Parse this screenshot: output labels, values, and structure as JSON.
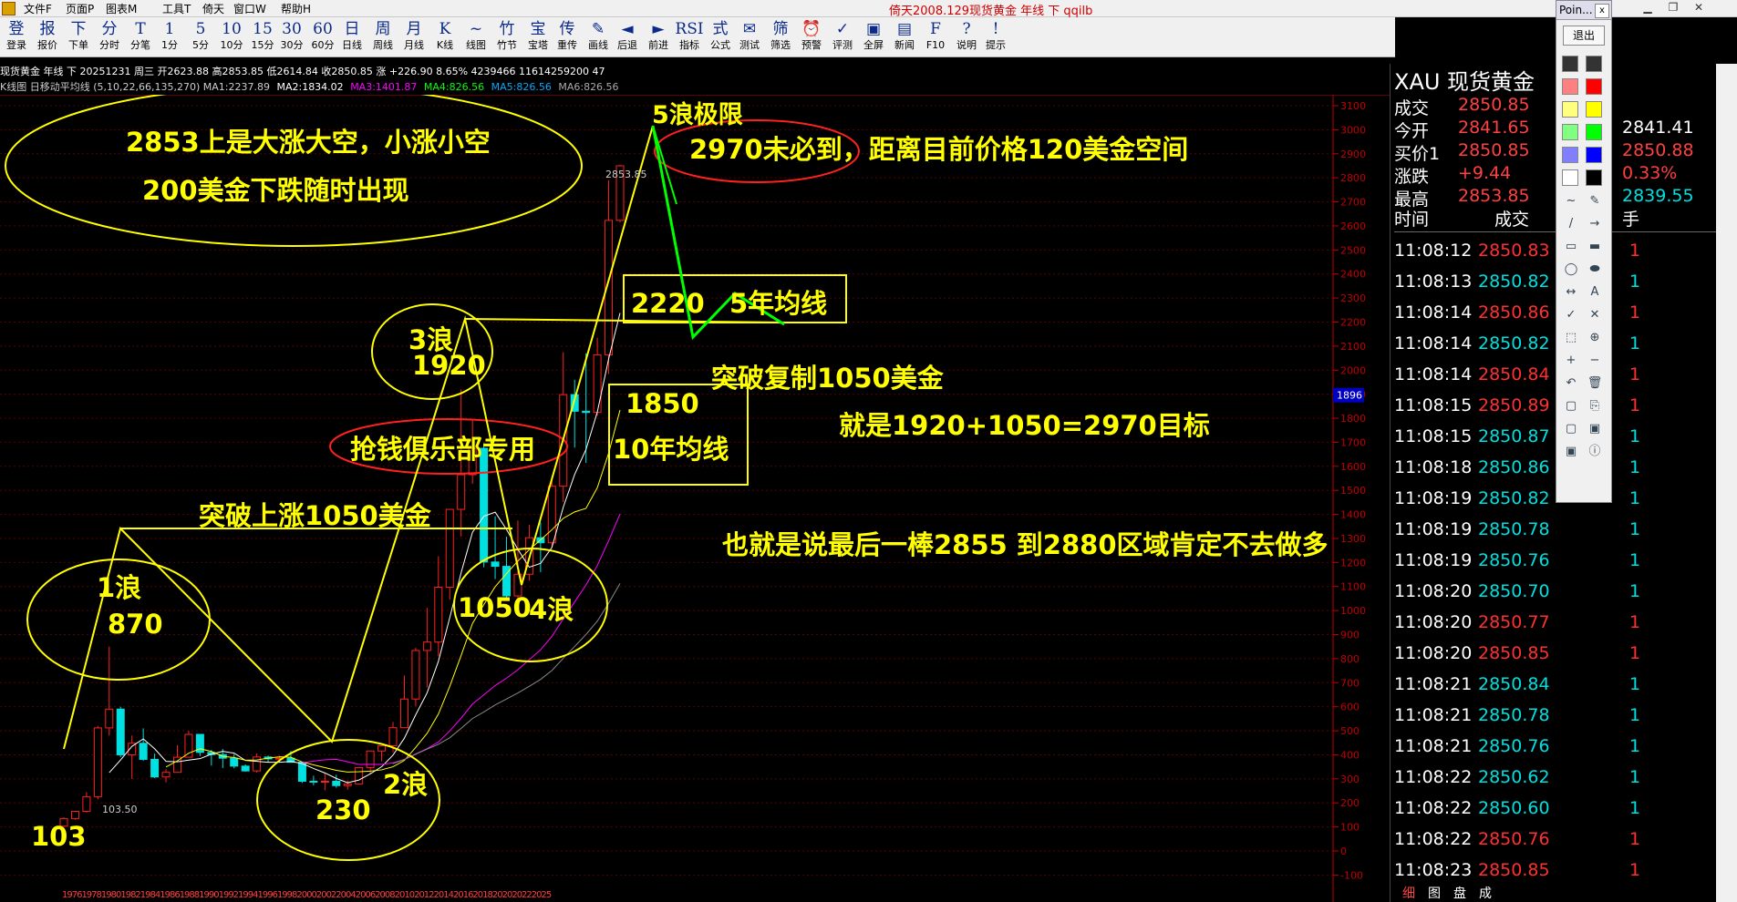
{
  "menu": [
    "文件F",
    "页面P",
    "图表M",
    "工具T",
    "倚天",
    "窗口W",
    "帮助H"
  ],
  "window_title": "倚天2008.129现货黄金 年线 下 qqilb",
  "toolbar": [
    {
      "icon": "登",
      "label": "登录"
    },
    {
      "icon": "报",
      "label": "报价"
    },
    {
      "icon": "下",
      "label": "下单"
    },
    {
      "icon": "分",
      "label": "分时"
    },
    {
      "icon": "T",
      "label": "分笔"
    },
    {
      "icon": "1",
      "label": "1分"
    },
    {
      "icon": "5",
      "label": "5分"
    },
    {
      "icon": "10",
      "label": "10分"
    },
    {
      "icon": "15",
      "label": "15分"
    },
    {
      "icon": "30",
      "label": "30分"
    },
    {
      "icon": "60",
      "label": "60分"
    },
    {
      "icon": "日",
      "label": "日线"
    },
    {
      "icon": "周",
      "label": "周线"
    },
    {
      "icon": "月",
      "label": "月线"
    },
    {
      "icon": "K",
      "label": "K线"
    },
    {
      "icon": "~",
      "label": "线图"
    },
    {
      "icon": "竹",
      "label": "竹节"
    },
    {
      "icon": "宝",
      "label": "宝塔"
    },
    {
      "icon": "传",
      "label": "重传"
    },
    {
      "icon": "✎",
      "label": "画线"
    },
    {
      "icon": "◄",
      "label": "后退"
    },
    {
      "icon": "►",
      "label": "前进"
    },
    {
      "icon": "RSI",
      "label": "指标"
    },
    {
      "icon": "式",
      "label": "公式"
    },
    {
      "icon": "✉",
      "label": "测试"
    },
    {
      "icon": "筛",
      "label": "筛选"
    },
    {
      "icon": "⏰",
      "label": "预警"
    },
    {
      "icon": "✓",
      "label": "评测"
    },
    {
      "icon": "▣",
      "label": "全屏"
    },
    {
      "icon": "▤",
      "label": "新闻"
    },
    {
      "icon": "F",
      "label": "F10"
    },
    {
      "icon": "?",
      "label": "说明"
    },
    {
      "icon": "!",
      "label": "提示"
    }
  ],
  "info1": "现货黄金 年线 下 20251231 周三 开2623.88 高2853.85 低2614.84 收2850.85 涨 +226.90 8.65% 4239466 11614259200 47",
  "info2": {
    "prefix": "K线图 日移动平均线 (5,10,22,66,135,270) MA1:2237.89",
    "ma2": "MA2:1834.02",
    "ma3": "MA3:1401.87",
    "ma4": "MA4:826.56",
    "ma5": "MA5:826.56",
    "ma6": "MA6:826.56",
    "colors": {
      "ma2": "#ffffff",
      "ma3": "#ff00ff",
      "ma4": "#00ff00",
      "ma5": "#00aaff",
      "ma6": "#aaaaaa"
    }
  },
  "price_axis": [
    "3100",
    "3000",
    "2900",
    "2800",
    "2700",
    "2600",
    "2500",
    "2400",
    "2300",
    "2200",
    "2100",
    "2000",
    "1900",
    "1800",
    "1700",
    "1600",
    "1500",
    "1400",
    "1300",
    "1200",
    "1100",
    "1000",
    "900",
    "800",
    "700",
    "600",
    "500",
    "400",
    "300",
    "200",
    "100",
    "0",
    "-100"
  ],
  "price_highlight": "1896",
  "chart_labels": {
    "high": "2853.85",
    "low": "103.50"
  },
  "x_axis_labels": "1976197819801982198419861988199019921994199619982000200220042006200820102012201420162018202020222025",
  "annotations": {
    "a1": "2853上是大涨大空，小涨小空",
    "a2": "200美金下跌随时出现",
    "a3": "5浪极限",
    "a4": "2970未必到，距离目前价格120美金空间",
    "a5": "2220",
    "a6": "5年均线",
    "a7": "3浪",
    "a8": "1920",
    "a9": "突破复制1050美金",
    "a10": "1850",
    "a11": "10年均线",
    "a12": "就是1920+1050=2970目标",
    "a13": "抢钱俱乐部专用",
    "a14": "突破上涨1050美金",
    "a15": "也就是说最后一棒2855 到2880区域肯定不去做多",
    "a16": "1浪",
    "a17": "870",
    "a18": "1050",
    "a19": "4浪",
    "a20": "230",
    "a21": "2浪",
    "a22": "103"
  },
  "quote": {
    "title": "XAU 现货黄金",
    "rows": [
      {
        "k1": "成交",
        "v1": "2850.85",
        "k2": "",
        "v2": ""
      },
      {
        "k1": "今开",
        "v1": "2841.65",
        "k2": "",
        "v2": "2841.41"
      },
      {
        "k1": "买价1",
        "v1": "2850.85",
        "k2": "",
        "v2": "2850.88"
      },
      {
        "k1": "涨跌",
        "v1": "+9.44",
        "k2": "",
        "v2": "0.33%"
      },
      {
        "k1": "最高",
        "v1": "2853.85",
        "k2": "",
        "v2": "2839.55"
      }
    ],
    "tick_header": [
      "时间",
      "成交",
      "手"
    ],
    "ticks": [
      {
        "t": "11:08:12",
        "p": "2850.83",
        "v": "1",
        "c": "#ff3030"
      },
      {
        "t": "11:08:13",
        "p": "2850.82",
        "v": "1",
        "c": "#00e0e0"
      },
      {
        "t": "11:08:14",
        "p": "2850.86",
        "v": "1",
        "c": "#ff3030"
      },
      {
        "t": "11:08:14",
        "p": "2850.82",
        "v": "1",
        "c": "#00e0e0"
      },
      {
        "t": "11:08:14",
        "p": "2850.84",
        "v": "1",
        "c": "#ff3030"
      },
      {
        "t": "11:08:15",
        "p": "2850.89",
        "v": "1",
        "c": "#ff3030"
      },
      {
        "t": "11:08:15",
        "p": "2850.87",
        "v": "1",
        "c": "#00e0e0"
      },
      {
        "t": "11:08:18",
        "p": "2850.86",
        "v": "1",
        "c": "#00e0e0"
      },
      {
        "t": "11:08:19",
        "p": "2850.82",
        "v": "1",
        "c": "#00e0e0"
      },
      {
        "t": "11:08:19",
        "p": "2850.78",
        "v": "1",
        "c": "#00e0e0"
      },
      {
        "t": "11:08:19",
        "p": "2850.76",
        "v": "1",
        "c": "#00e0e0"
      },
      {
        "t": "11:08:20",
        "p": "2850.70",
        "v": "1",
        "c": "#00e0e0"
      },
      {
        "t": "11:08:20",
        "p": "2850.77",
        "v": "1",
        "c": "#ff3030"
      },
      {
        "t": "11:08:20",
        "p": "2850.85",
        "v": "1",
        "c": "#ff3030"
      },
      {
        "t": "11:08:21",
        "p": "2850.84",
        "v": "1",
        "c": "#00e0e0"
      },
      {
        "t": "11:08:21",
        "p": "2850.78",
        "v": "1",
        "c": "#00e0e0"
      },
      {
        "t": "11:08:21",
        "p": "2850.76",
        "v": "1",
        "c": "#00e0e0"
      },
      {
        "t": "11:08:22",
        "p": "2850.62",
        "v": "1",
        "c": "#00e0e0"
      },
      {
        "t": "11:08:22",
        "p": "2850.60",
        "v": "1",
        "c": "#00e0e0"
      },
      {
        "t": "11:08:22",
        "p": "2850.76",
        "v": "1",
        "c": "#ff3030"
      },
      {
        "t": "11:08:23",
        "p": "2850.85",
        "v": "1",
        "c": "#ff3030"
      }
    ]
  },
  "bottom_tabs": [
    "细",
    "图",
    "盘",
    "成"
  ],
  "toolbox": {
    "title": "Poin...",
    "exit": "退出"
  }
}
